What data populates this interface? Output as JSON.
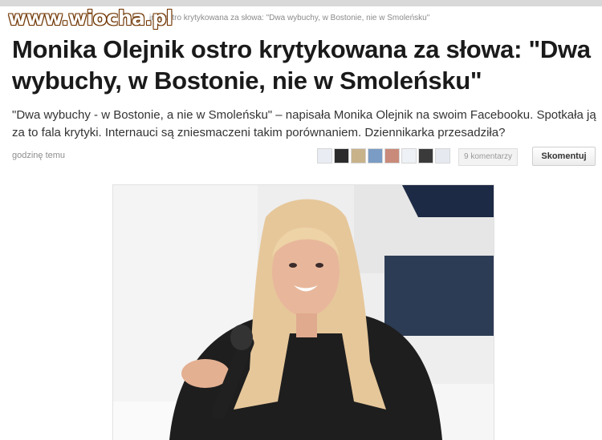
{
  "watermark": {
    "text": "www.wiocha.pl"
  },
  "breadcrumb": {
    "text": "jnik ostro krytykowana za słowa: \"Dwa wybuchy, w Bostonie, nie w Smoleńsku\""
  },
  "article": {
    "headline": "Monika Olejnik ostro krytykowana za słowa: \"Dwa wybuchy, w Bostonie, nie w Smoleńsku\"",
    "lead": "\"Dwa wybuchy - w Bostonie, a nie w Smoleńsku\" – napisała Monika Olejnik na swoim Facebooku. Spotkała ją za to fala krytyki. Internauci są zniesmaczeni takim porównaniem. Dziennikarka przesadziła?",
    "timestamp": "godzinę temu",
    "comments_count": "9 komentarzy",
    "comment_button": "Skomentuj"
  },
  "colors": {
    "watermark_outline": "#7a3a00",
    "headline": "#1a1a1a",
    "muted": "#8e8e8e"
  }
}
